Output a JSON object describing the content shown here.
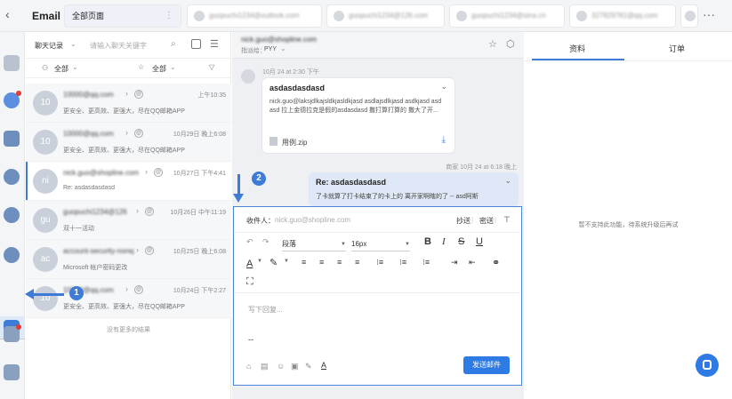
{
  "app": {
    "title": "Email"
  },
  "tabs": [
    {
      "label": "全部页面",
      "active": true
    },
    {
      "label": "guopuchi1234@outlook.com"
    },
    {
      "label": "guopuchi1234@126.com"
    },
    {
      "label": "guopuchi1234@sina.cn"
    },
    {
      "label": "327829781@qq.com"
    }
  ],
  "list": {
    "filter_select": "聊天记录",
    "search_placeholder": "请输入聊天关键字",
    "filter_all_1": "全部",
    "filter_all_2": "全部",
    "rows": [
      {
        "avatar": "10",
        "sender": "10000@qq.com",
        "time": "上午10:35",
        "preview": "更安全、更高效、更强大，尽在QQ邮箱APP",
        "active": false
      },
      {
        "avatar": "10",
        "sender": "10000@qq.com",
        "time": "10月29日 晚上6:08",
        "preview": "更安全、更高效、更强大，尽在QQ邮箱APP",
        "active": false
      },
      {
        "avatar": "ni",
        "sender": "nick.guo@shopline.com",
        "time": "10月27日 下午4:41",
        "preview": "Re: asdasdasdasd",
        "active": true
      },
      {
        "avatar": "gu",
        "sender": "guopuchi1234@126",
        "time": "10月26日 中午11:19",
        "preview": "双十一活动",
        "active": false
      },
      {
        "avatar": "ac",
        "sender": "account-security-noreply",
        "time": "10月25日 晚上6:08",
        "preview": "Microsoft 帐户密码更改",
        "active": false
      },
      {
        "avatar": "10",
        "sender": "10000@qq.com",
        "time": "10月24日 下午2:27",
        "preview": "更安全、更高效、更强大，尽在QQ邮箱APP",
        "active": false
      }
    ],
    "no_more": "没有更多的结果"
  },
  "chat": {
    "to_address": "nick.guo@shopline.com",
    "assign_label": "指派给：",
    "assign_value": "PYY",
    "incoming_time": "10月 24 at 2:30 下午",
    "incoming_subject": "asdasdasdasd",
    "incoming_body": "nick.guo@laksjdlkajsldkjasldkjasd asdlajsdlkjasd asdkjasd asd asd 拉上金德拉克是假的asdasdasd 撒打算打算的 撒大了开...",
    "attachment_name": "用例.zip",
    "sent_meta": "商家 10月 24 at 6:18 晚上",
    "sent_subject": "Re: asdasdasdasd",
    "sent_preview": "了卡就算了打卡结束了的卡上的 离开家啊瞎的了 -- asd阿斯"
  },
  "composer": {
    "recipient_label": "收件人：",
    "recipient_value": "nick.guo@shopline.com",
    "cc_label": "抄送",
    "bcc_label": "密送",
    "paragraph_select": "段落",
    "fontsize_select": "16px",
    "placeholder": "写下回复...",
    "signature": "--",
    "send_label": "发送邮件"
  },
  "side": {
    "tab_profile": "资料",
    "tab_orders": "订单",
    "unsupported_text": "暂不支持此功能，待系统升级后再试"
  },
  "annotations": {
    "step1": "1",
    "step2": "2"
  },
  "colors": {
    "accent": "#3d7bd6",
    "send_button": "#2e7be6",
    "composer_border": "#4c86d8"
  }
}
